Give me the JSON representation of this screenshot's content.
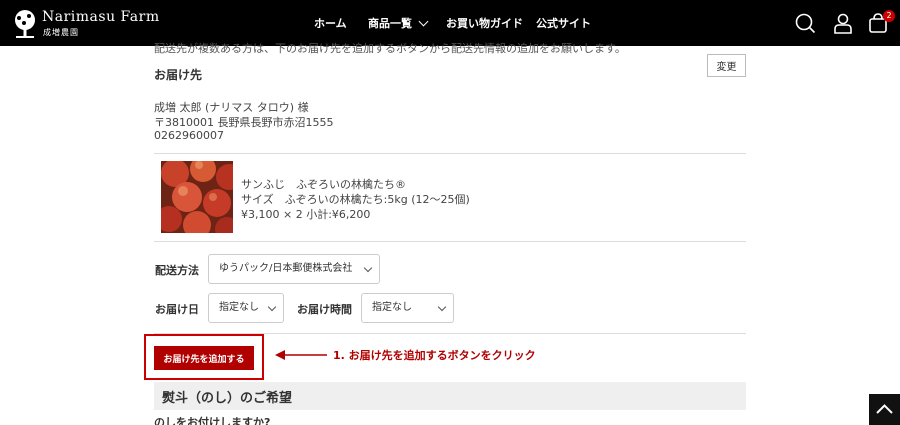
{
  "header": {
    "logo": {
      "name": "Narimasu Farm",
      "subtitle": "成増農園"
    },
    "nav": [
      {
        "label": "ホーム"
      },
      {
        "label": "商品一覧",
        "has_dropdown": true
      },
      {
        "label": "お買い物ガイド"
      },
      {
        "label": "公式サイト"
      }
    ],
    "icons": [
      "search-icon",
      "account-icon",
      "cart-icon"
    ],
    "cart_count": "2"
  },
  "main": {
    "cut_off_text": "配送先が複数ある方は、下のお届け先を追加するボタンから配送先情報の追加をお願いします。",
    "delivery_section": {
      "title": "お届け先",
      "change_label": "変更",
      "name": "成増 太郎 (ナリマス タロウ) 様",
      "address": "〒3810001 長野県長野市赤沼1555",
      "phone": "0262960007"
    },
    "product": {
      "name": "サンふじ　ふぞろいの林檎たち®",
      "size": "サイズ　ふぞろいの林檎たち:5kg (12〜25個)",
      "price": "¥3,100 × 2  小計:¥6,200"
    },
    "shipping": {
      "method_label": "配送方法",
      "method_value": "ゆうパック/日本郵便株式会社",
      "date_label": "お届け日",
      "date_value": "指定なし",
      "time_label": "お届け時間",
      "time_value": "指定なし"
    },
    "add_delivery_button": "お届け先を追加する",
    "instruction": "1. お届け先を追加するボタンをクリック",
    "noshi": {
      "title": "熨斗（のし）のご希望",
      "question": "のしをお付けしますか?"
    }
  },
  "colors": {
    "header_bg": "#000000",
    "accent_red": "#b00000",
    "badge_red": "#cc0000"
  }
}
